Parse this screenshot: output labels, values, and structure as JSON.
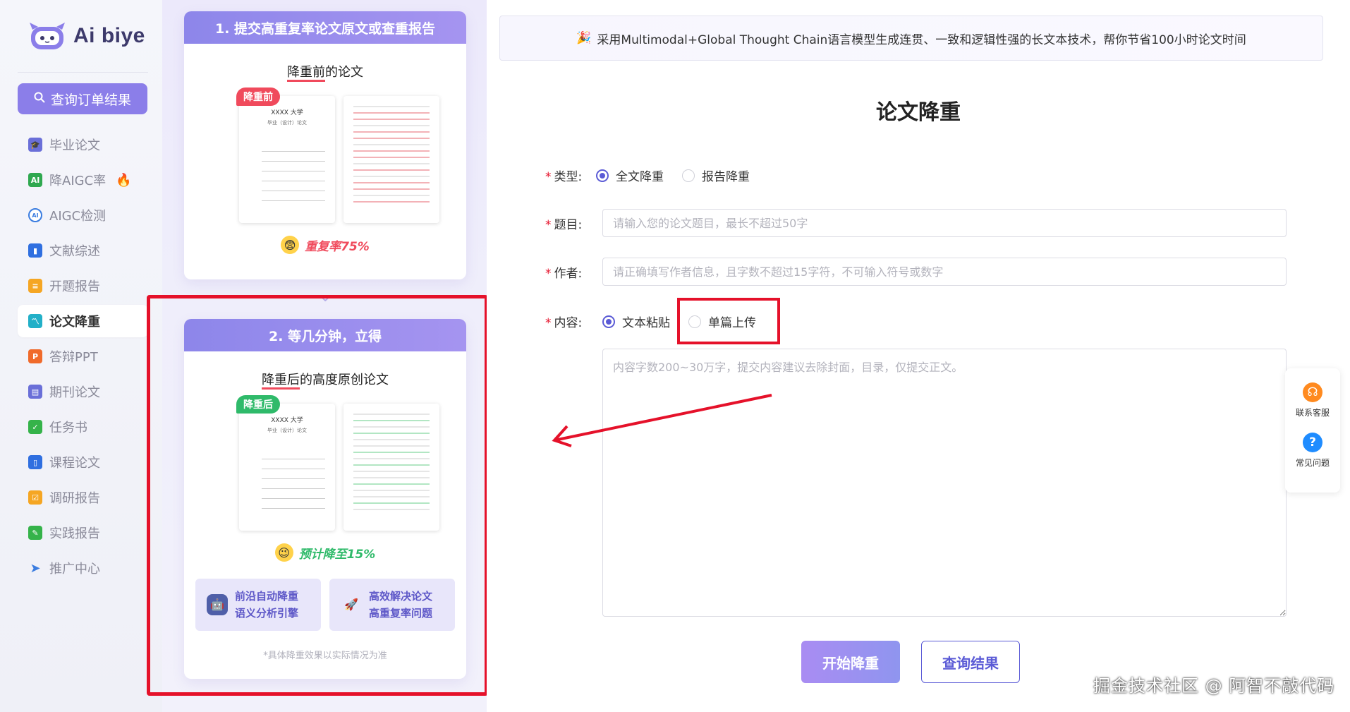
{
  "app": {
    "name": "Ai biye"
  },
  "sidebar": {
    "query_button": "查询订单结果",
    "items": [
      {
        "label": "毕业论文",
        "icon": "graduation-cap-icon",
        "color": "#6a6fd8"
      },
      {
        "label": "降AIGC率",
        "icon": "ai-badge-icon",
        "color": "#2fa84f",
        "hot": true
      },
      {
        "label": "AIGC检测",
        "icon": "ai-check-icon",
        "color": "#3b7de0"
      },
      {
        "label": "文献综述",
        "icon": "book-icon",
        "color": "#2f6fe0"
      },
      {
        "label": "开题报告",
        "icon": "report-icon",
        "color": "#f5a623"
      },
      {
        "label": "论文降重",
        "icon": "chart-icon",
        "color": "#22b0c8",
        "active": true
      },
      {
        "label": "答辩PPT",
        "icon": "ppt-icon",
        "color": "#f06a2b"
      },
      {
        "label": "期刊论文",
        "icon": "journal-icon",
        "color": "#6a6fd8"
      },
      {
        "label": "任务书",
        "icon": "task-icon",
        "color": "#35b34a"
      },
      {
        "label": "课程论文",
        "icon": "course-icon",
        "color": "#2f6fe0"
      },
      {
        "label": "调研报告",
        "icon": "survey-icon",
        "color": "#f5a623"
      },
      {
        "label": "实践报告",
        "icon": "practice-icon",
        "color": "#35b34a"
      },
      {
        "label": "推广中心",
        "icon": "send-icon",
        "color": "#3b7de0"
      }
    ]
  },
  "promo": {
    "step1": {
      "title": "1. 提交高重复率论文原文或查重报告",
      "subtitle_underlined": "降重前",
      "subtitle_rest": "的论文",
      "tag": "降重前",
      "doc_title": "XXXX 大学",
      "doc_sub": "毕业（设计）论文",
      "rate": "重复率75%"
    },
    "step2": {
      "title": "2. 等几分钟，立得",
      "subtitle_underlined": "降重后",
      "subtitle_rest": "的高度原创论文",
      "tag": "降重后",
      "doc_title": "XXXX 大学",
      "doc_sub": "毕业（设计）论文",
      "rate": "预计降至15%",
      "features": [
        {
          "line1": "前沿自动降重",
          "line2": "语义分析引擎",
          "icon": "robot-icon"
        },
        {
          "line1": "高效解决论文",
          "line2": "高重复率问题",
          "icon": "rocket-icon"
        }
      ],
      "note": "*具体降重效果以实际情况为准"
    }
  },
  "main": {
    "banner": "采用Multimodal+Global Thought Chain语言模型生成连贯、一致和逻辑性强的长文本技术，帮你节省100小时论文时间",
    "title": "论文降重",
    "type_label": "类型:",
    "type_options": [
      "全文降重",
      "报告降重"
    ],
    "topic_label": "题目:",
    "topic_placeholder": "请输入您的论文题目，最长不超过50字",
    "author_label": "作者:",
    "author_placeholder": "请正确填写作者信息，且字数不超过15字符，不可输入符号或数字",
    "content_label": "内容:",
    "content_options": [
      "文本粘贴",
      "单篇上传"
    ],
    "content_placeholder": "内容字数200~30万字，提交内容建议去除封面，目录，仅提交正文。",
    "start_button": "开始降重",
    "query_button": "查询结果"
  },
  "float": {
    "service": "联系客服",
    "faq": "常见问题"
  },
  "watermark": "掘金技术社区 @ 阿智不敲代码",
  "colors": {
    "accent": "#5b5bd6",
    "highlight": "#e5112a",
    "brand": "#8b7ee9"
  }
}
